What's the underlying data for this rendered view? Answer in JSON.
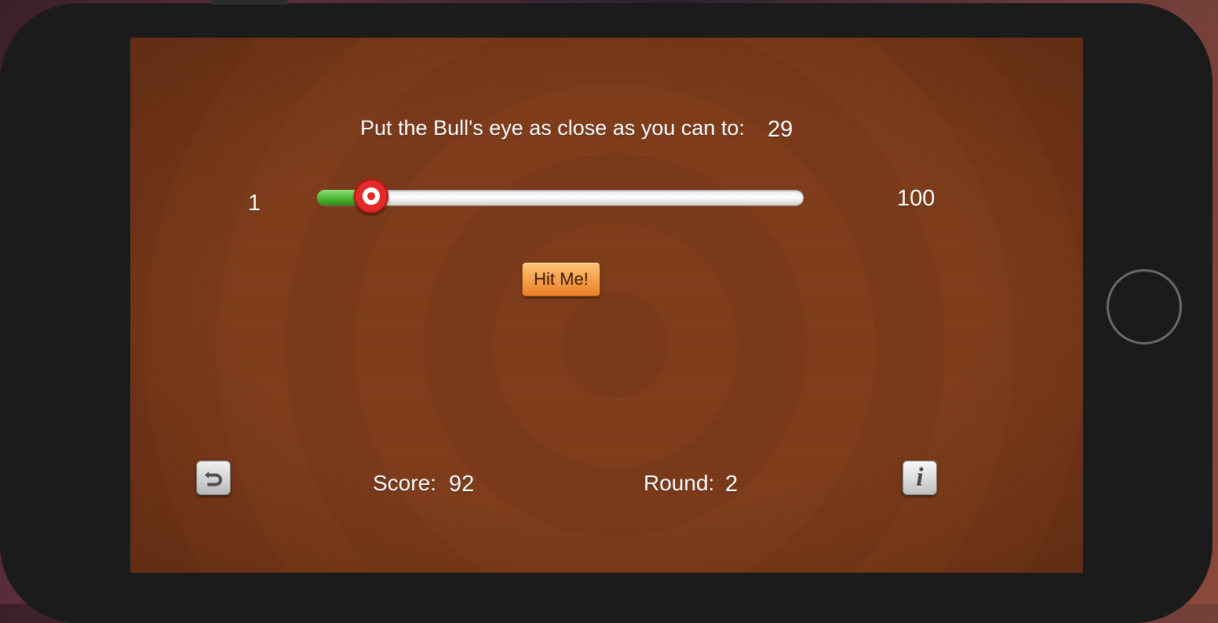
{
  "game": {
    "instruction": "Put the Bull's eye as close as you can to:",
    "target_value": "29",
    "slider": {
      "min_label": "1",
      "max_label": "100",
      "value": 12,
      "min": 1,
      "max": 100
    },
    "hit_button_label": "Hit Me!",
    "score_label": "Score:",
    "score_value": "92",
    "round_label": "Round:",
    "round_value": "2"
  },
  "icons": {
    "restart": "restart-arrow-icon",
    "info": "info-icon"
  },
  "colors": {
    "background": "#7b3a1a",
    "slider_fill": "#4bb52f",
    "thumb_red": "#e22a2a",
    "button_orange": "#f5a14a"
  }
}
